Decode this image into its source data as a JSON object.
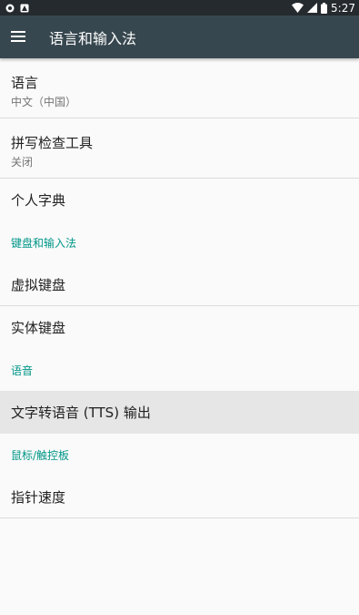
{
  "statusbar": {
    "time": "5:27"
  },
  "toolbar": {
    "title": "语言和输入法"
  },
  "list": {
    "language": {
      "title": "语言",
      "summary": "中文（中国）"
    },
    "spellcheck": {
      "title": "拼写检查工具",
      "summary": "关闭"
    },
    "dictionary": {
      "title": "个人字典"
    },
    "cat_keyboard": "键盘和输入法",
    "virtual_keyboard": {
      "title": "虚拟键盘"
    },
    "physical_keyboard": {
      "title": "实体键盘"
    },
    "cat_speech": "语音",
    "tts": {
      "title": "文字转语音 (TTS) 输出"
    },
    "cat_pointer": "鼠标/触控板",
    "pointer_speed": {
      "title": "指针速度"
    }
  },
  "colors": {
    "statusbar": "#252a2e",
    "toolbar": "#37474f",
    "accent": "#009688",
    "background": "#fafafa"
  }
}
